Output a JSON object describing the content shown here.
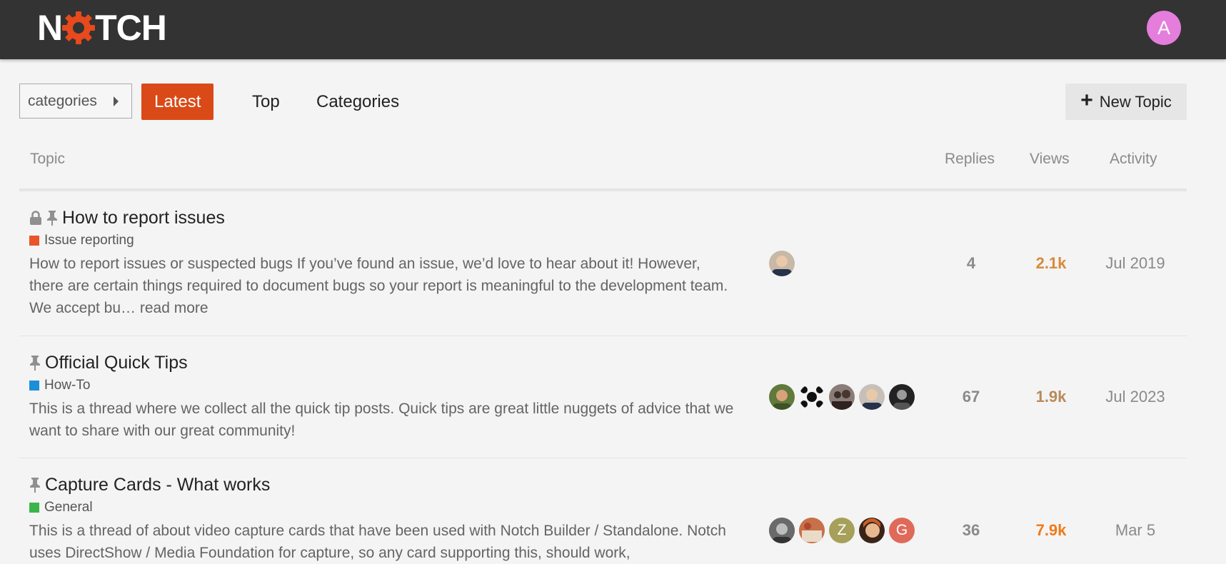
{
  "header": {
    "logo_text_before": "N",
    "logo_text_after": "TCH",
    "user_avatar_letter": "A",
    "user_avatar_color": "#e57ddc"
  },
  "nav": {
    "category_dropdown": "categories",
    "tabs": [
      {
        "label": "Latest",
        "active": true
      },
      {
        "label": "Top",
        "active": false
      },
      {
        "label": "Categories",
        "active": false
      }
    ],
    "new_topic_label": "New Topic"
  },
  "columns": {
    "topic": "Topic",
    "replies": "Replies",
    "views": "Views",
    "activity": "Activity"
  },
  "topics": [
    {
      "title": "How to report issues",
      "locked": true,
      "pinned": true,
      "category": "Issue reporting",
      "category_color": "#e9542a",
      "excerpt": "How to report issues or suspected bugs If you’ve found an issue, we’d love to hear about it! However, there are certain things required to document bugs so your report is meaningful to the development team. We accept bu…",
      "read_more": "read more",
      "replies": "4",
      "views": "2.1k",
      "views_color": "#d98a3a",
      "activity": "Jul 2019"
    },
    {
      "title": "Official Quick Tips",
      "locked": false,
      "pinned": true,
      "category": "How-To",
      "category_color": "#1b8fd9",
      "excerpt": "This is a thread where we collect all the quick tip posts. Quick tips are great little nuggets of advice that we want to share with our great community!",
      "replies": "67",
      "views": "1.9k",
      "views_color": "#b98a5a",
      "activity": "Jul 2023"
    },
    {
      "title": "Capture Cards - What works",
      "locked": false,
      "pinned": true,
      "category": "General",
      "category_color": "#3ab54a",
      "excerpt": "This is a thread of about video capture cards that have been used with Notch Builder / Standalone. Notch uses DirectShow / Media Foundation for capture, so any card supporting this, should work,",
      "replies": "36",
      "views": "7.9k",
      "views_color": "#f07a1a",
      "activity": "Mar 5",
      "letter_avatars": [
        "Z",
        "G"
      ]
    }
  ]
}
